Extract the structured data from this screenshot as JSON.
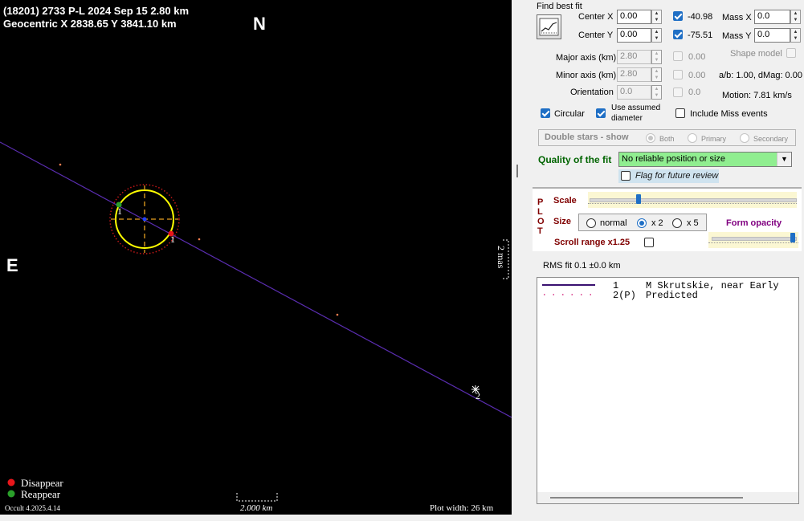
{
  "plot": {
    "title_line1": "(18201) 2733 P-L  2024 Sep 15   2.80 km",
    "title_line2": "Geocentric  X  2838.65  Y 3841.10 km",
    "north_label": "N",
    "east_label": "E",
    "scale_mas_label": "2 mas",
    "chord_label_1": "1",
    "chord_label_2": "2",
    "legend_disappear": "Disappear",
    "legend_reappear": "Reappear",
    "version": "Occult 4.2025.4.14",
    "scale_bar_label": "2.000 km",
    "plot_width_label": "Plot width: 26 km",
    "colors": {
      "disappear": "#e8161b",
      "reappear": "#2aa02a",
      "ellipse": "#ffff00",
      "chord": "#5a2db0"
    }
  },
  "panel": {
    "find_best_fit": "Find best fit",
    "center_x_label": "Center X",
    "center_x_value": "0.00",
    "center_y_label": "Center Y",
    "center_y_value": "0.00",
    "center_x_fit": "-40.98",
    "center_y_fit": "-75.51",
    "mass_x_label": "Mass X",
    "mass_x_value": "0.0",
    "mass_y_label": "Mass Y",
    "mass_y_value": "0.0",
    "shape_model_label": "Shape model",
    "major_axis_label": "Major axis (km)",
    "major_axis_value": "2.80",
    "major_axis_fit": "0.00",
    "minor_axis_label": "Minor axis (km)",
    "minor_axis_value": "2.80",
    "minor_axis_fit": "0.00",
    "orientation_label": "Orientation",
    "orientation_value": "0.0",
    "orientation_fit": "0.0",
    "ab_dmag": "a/b: 1.00, dMag: 0.00",
    "motion": "Motion: 7.81 km/s",
    "circular_label": "Circular",
    "use_assumed_line1": "Use assumed",
    "use_assumed_line2": "diameter",
    "include_miss_label": "Include Miss events",
    "double_stars_label": "Double stars - show",
    "both_label": "Both",
    "primary_label": "Primary",
    "secondary_label": "Secondary",
    "quality_label": "Quality of the fit",
    "quality_value": "No reliable position or size",
    "flag_review_label": "Flag for future review",
    "plot_vertical": [
      "P",
      "L",
      "O",
      "T"
    ],
    "scale_label": "Scale",
    "size_label": "Size",
    "size_normal": "normal",
    "size_x2": "x 2",
    "size_x5": "x 5",
    "form_opacity_label": "Form opacity",
    "scroll_range_label": "Scroll range x1.25",
    "rms_fit": "RMS fit  0.1 ±0.0 km",
    "list_rows": [
      {
        "index": "1",
        "text": "M Skrutskie, near Early"
      },
      {
        "index": "2(P)",
        "text": "Predicted"
      }
    ],
    "colors": {
      "quality_fill": "#90ee90",
      "title_green": "#006400",
      "accent": "#1f6fc5",
      "form_opacity_text": "#800080"
    }
  }
}
